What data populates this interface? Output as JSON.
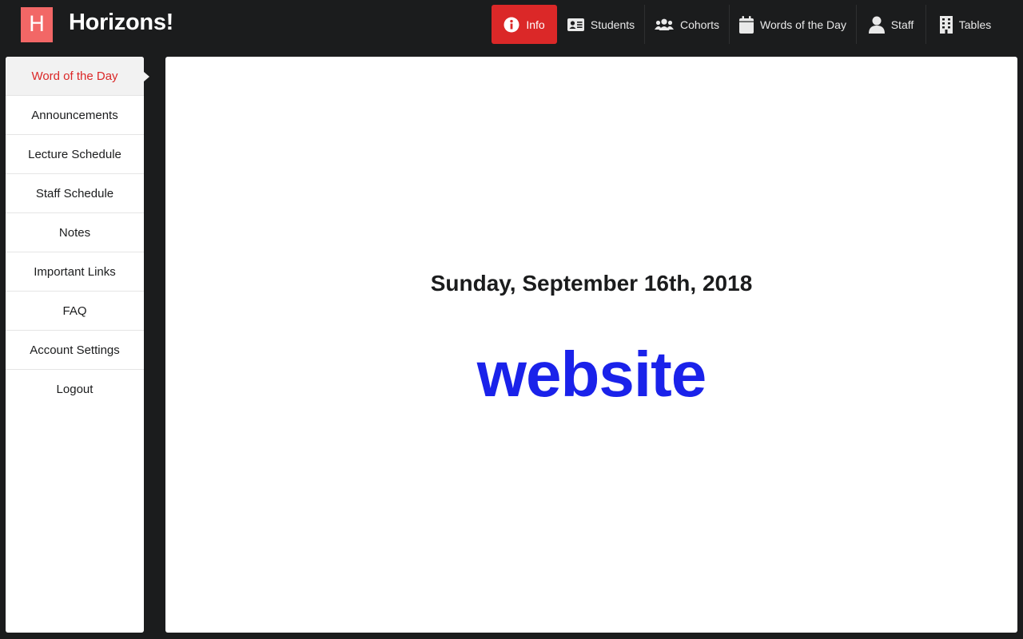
{
  "app": {
    "logo_letter": "H",
    "name": "Horizons!"
  },
  "nav": [
    {
      "label": "Info",
      "icon": "info-circle-icon",
      "active": true
    },
    {
      "label": "Students",
      "icon": "id-card-icon"
    },
    {
      "label": "Cohorts",
      "icon": "users-icon"
    },
    {
      "label": "Words of the Day",
      "icon": "calendar-icon"
    },
    {
      "label": "Staff",
      "icon": "user-icon"
    },
    {
      "label": "Tables",
      "icon": "building-icon"
    }
  ],
  "sidebar": {
    "items": [
      {
        "label": "Word of the Day",
        "active": true
      },
      {
        "label": "Announcements"
      },
      {
        "label": "Lecture Schedule"
      },
      {
        "label": "Staff Schedule"
      },
      {
        "label": "Notes"
      },
      {
        "label": "Important Links"
      },
      {
        "label": "FAQ"
      },
      {
        "label": "Account Settings"
      },
      {
        "label": "Logout"
      }
    ]
  },
  "main": {
    "date": "Sunday, September 16th, 2018",
    "word": "website"
  },
  "colors": {
    "accent": "#db2828",
    "logo": "#f26766",
    "word": "#1a22ea",
    "background": "#1b1c1d"
  }
}
